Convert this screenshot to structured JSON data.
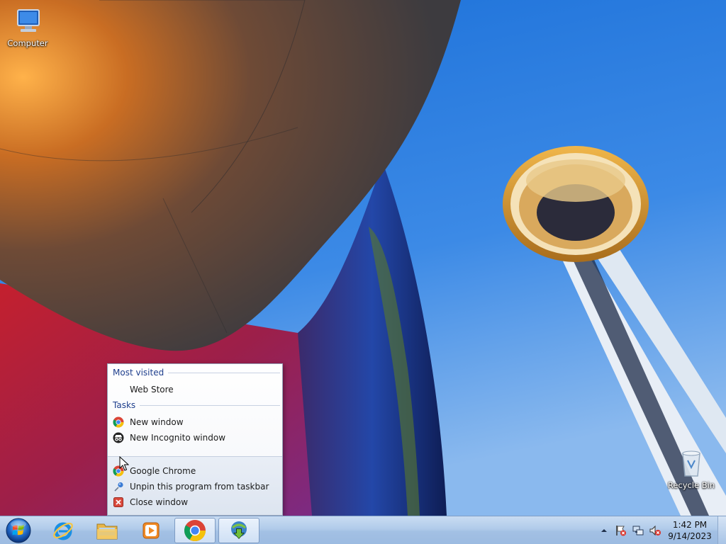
{
  "desktop": {
    "icons": [
      {
        "label": "Computer",
        "icon": "computer-icon"
      },
      {
        "label": "Recycle Bin",
        "icon": "recycle-bin-icon"
      }
    ]
  },
  "jumplist": {
    "most_visited_header": "Most visited",
    "most_visited": [
      {
        "label": "Web Store"
      }
    ],
    "tasks_header": "Tasks",
    "tasks": [
      {
        "label": "New window",
        "icon": "chrome-icon"
      },
      {
        "label": "New Incognito window",
        "icon": "incognito-icon"
      }
    ],
    "footer": [
      {
        "label": "Google Chrome",
        "icon": "chrome-icon"
      },
      {
        "label": "Unpin this program from taskbar",
        "icon": "unpin-icon"
      },
      {
        "label": "Close window",
        "icon": "close-icon"
      }
    ]
  },
  "taskbar": {
    "buttons": [
      {
        "name": "Internet Explorer",
        "icon": "internet-explorer-icon"
      },
      {
        "name": "Windows Explorer",
        "icon": "folder-icon"
      },
      {
        "name": "Windows Media Player",
        "icon": "media-player-icon"
      },
      {
        "name": "Google Chrome",
        "icon": "chrome-icon"
      },
      {
        "name": "Internet Download Manager",
        "icon": "idm-icon"
      }
    ],
    "tray_icons": [
      "show-hidden-icons-arrow",
      "action-center-flag-icon",
      "network-icon",
      "volume-muted-icon"
    ],
    "clock": {
      "time": "1:42 PM",
      "date": "9/14/2023"
    }
  },
  "colors": {
    "sky": "#2f7fe0",
    "jumplist_header": "#1e3e8c",
    "taskbar": "#b1cbea"
  }
}
